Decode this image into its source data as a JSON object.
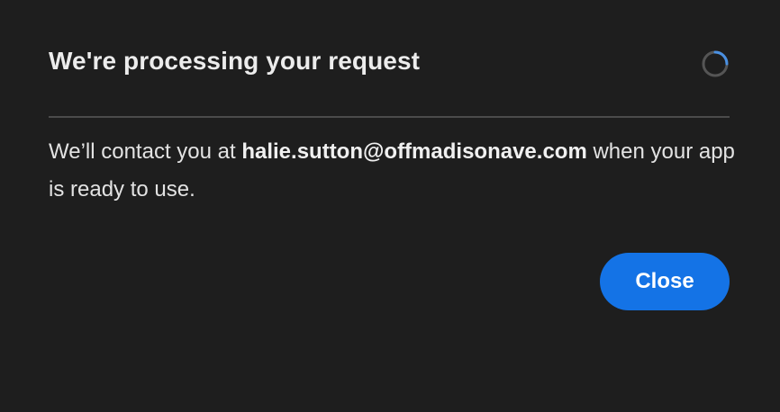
{
  "dialog": {
    "title": "We're processing your request",
    "message_before": "We’ll contact you at ",
    "email": "halie.sutton@offmadisonave.com",
    "message_after": " when your app is ready to use.",
    "close_label": "Close",
    "spinner_icon": "loading-spinner-icon"
  },
  "colors": {
    "background": "#1e1e1e",
    "primary_button": "#1473e6",
    "spinner_track": "#555555",
    "spinner_accent": "#4a90e2",
    "divider": "#4b4b4b"
  }
}
